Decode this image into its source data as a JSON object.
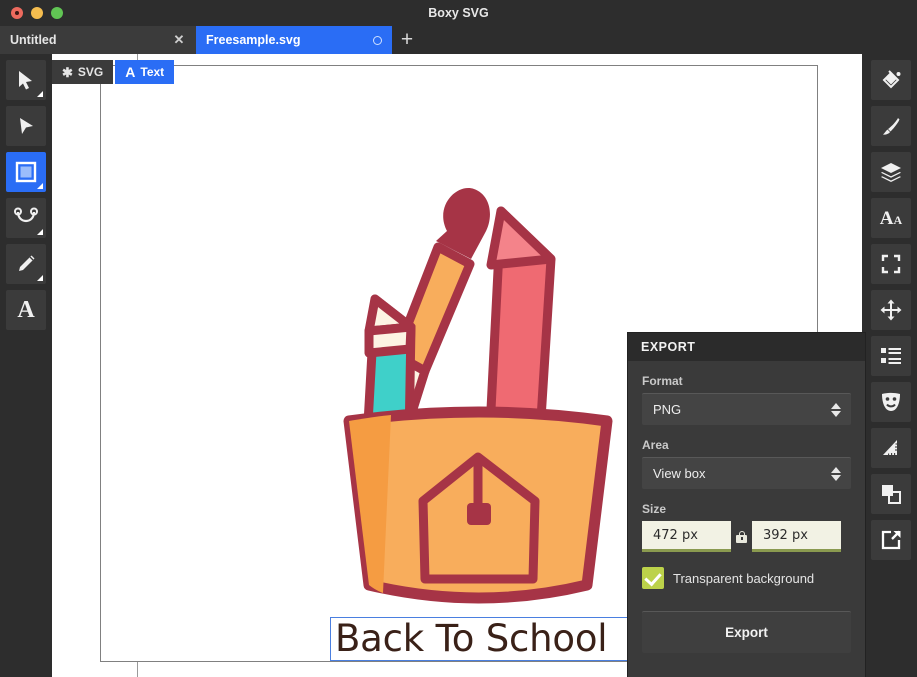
{
  "window": {
    "title": "Boxy SVG",
    "traffic_lights": [
      "close-red",
      "minimize-yellow",
      "maximize-green"
    ]
  },
  "tabstrip": {
    "tabs": [
      {
        "label": "Untitled",
        "active": false,
        "close_glyph": "✕"
      },
      {
        "label": "Freesample.svg",
        "active": true,
        "indicator": "unsaved-dot"
      }
    ],
    "new_tab_glyph": "+"
  },
  "context_tabs": [
    {
      "label": "SVG",
      "icon": "✱",
      "icon_name": "asterisk-icon",
      "active": false
    },
    {
      "label": "Text",
      "icon": "A",
      "icon_name": "letter-a-icon",
      "active": true
    }
  ],
  "left_toolbar": {
    "tools": [
      {
        "name": "select-tool",
        "active": false,
        "has_corner": true
      },
      {
        "name": "node-edit-tool",
        "active": false,
        "has_corner": false
      },
      {
        "name": "rectangle-tool",
        "active": true,
        "has_corner": true
      },
      {
        "name": "bezier-tool",
        "active": false,
        "has_corner": true
      },
      {
        "name": "pencil-tool",
        "active": false,
        "has_corner": true
      },
      {
        "name": "text-tool",
        "active": false,
        "has_corner": false,
        "glyph": "A"
      }
    ]
  },
  "right_toolbar": {
    "tools": [
      {
        "name": "fill-bucket-panel",
        "active": false
      },
      {
        "name": "brush-stroke-panel",
        "active": false
      },
      {
        "name": "layers-panel",
        "active": false
      },
      {
        "name": "typography-panel",
        "active": false,
        "glyph": "Aa"
      },
      {
        "name": "geometry-panel",
        "active": false
      },
      {
        "name": "transform-panel",
        "active": false
      },
      {
        "name": "elements-list-panel",
        "active": false
      },
      {
        "name": "effects-mask-panel",
        "active": false
      },
      {
        "name": "measure-panel",
        "active": false
      },
      {
        "name": "arrange-boolean-panel",
        "active": false
      },
      {
        "name": "export-panel",
        "active": true
      }
    ]
  },
  "export_panel": {
    "title": "EXPORT",
    "format": {
      "label": "Format",
      "value": "PNG"
    },
    "area": {
      "label": "Area",
      "value": "View box"
    },
    "size": {
      "label": "Size",
      "width": "472 px",
      "height": "392 px",
      "link_locked": true
    },
    "transparent_background": {
      "label": "Transparent background",
      "checked": true,
      "accent": "#bcd24a"
    },
    "export_button": "Export"
  },
  "canvas": {
    "text_object": {
      "value": "Back To School",
      "selected": true,
      "fill": "#3a2118",
      "selection_color": "#4a7fe0"
    },
    "artwork_name": "back-to-school-pencil-cup-illustration",
    "palette": {
      "dark_red": "#a63446",
      "pink": "#ef6a72",
      "orange": "#f59c42",
      "orange_light": "#f8ad5c",
      "cream": "#fdf3e3",
      "teal": "#3fd0c9"
    }
  },
  "theme": {
    "accent_blue": "#2a6df5",
    "chrome_dark": "#2d2d2d",
    "panel_bg": "#3a3a3a",
    "panel_header": "#2b2b2b"
  }
}
